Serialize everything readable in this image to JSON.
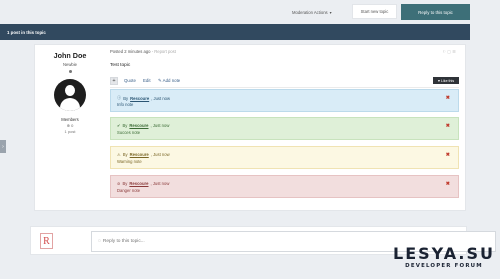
{
  "toolbar": {
    "moderation_label": "Moderation Actions",
    "start_topic_label": "Start new topic",
    "reply_label": "Reply to this topic"
  },
  "topic": {
    "post_count": "1 post in this topic"
  },
  "sidebar_toggle": {
    "label": "›"
  },
  "author": {
    "name": "John Doe",
    "rank": "Newbie",
    "group": "Members",
    "reputation": "0",
    "posts": "1 post"
  },
  "post": {
    "meta": "Posted 2 minutes ago",
    "report": "Report post",
    "body": "Test topic",
    "tools": "⚐ ▢ ☰"
  },
  "actions": {
    "plus": "+",
    "quote": "Quote",
    "edit": "Edit",
    "add_note": "Add note",
    "like": "Like this"
  },
  "notes": [
    {
      "type": "info",
      "icon": "ⓘ",
      "by": "By",
      "author": "Rescoure",
      "time": ", Just now",
      "text": "Info note",
      "close": "✖"
    },
    {
      "type": "success",
      "icon": "✔",
      "by": "By",
      "author": "Rescoure",
      "time": ", Just now",
      "text": "Succes note",
      "close": "✖"
    },
    {
      "type": "warning",
      "icon": "⚠",
      "by": "By",
      "author": "Rescoure",
      "time": ", Just now",
      "text": "Warning note",
      "close": "✖"
    },
    {
      "type": "danger",
      "icon": "⊘",
      "by": "By",
      "author": "Rescoure",
      "time": ", Just now",
      "text": "Danger note",
      "close": "✖"
    }
  ],
  "reply": {
    "placeholder": "Reply to this topic..."
  },
  "watermark": {
    "title": "LESYA.SU",
    "subtitle": "DEVELOPER FORUM"
  },
  "colors": {
    "accent": "#3d6f78",
    "topic_bar": "#31495f",
    "info": "#d9ecf7",
    "success": "#dff0d8",
    "warning": "#fcf8e3",
    "danger": "#f2dede"
  }
}
